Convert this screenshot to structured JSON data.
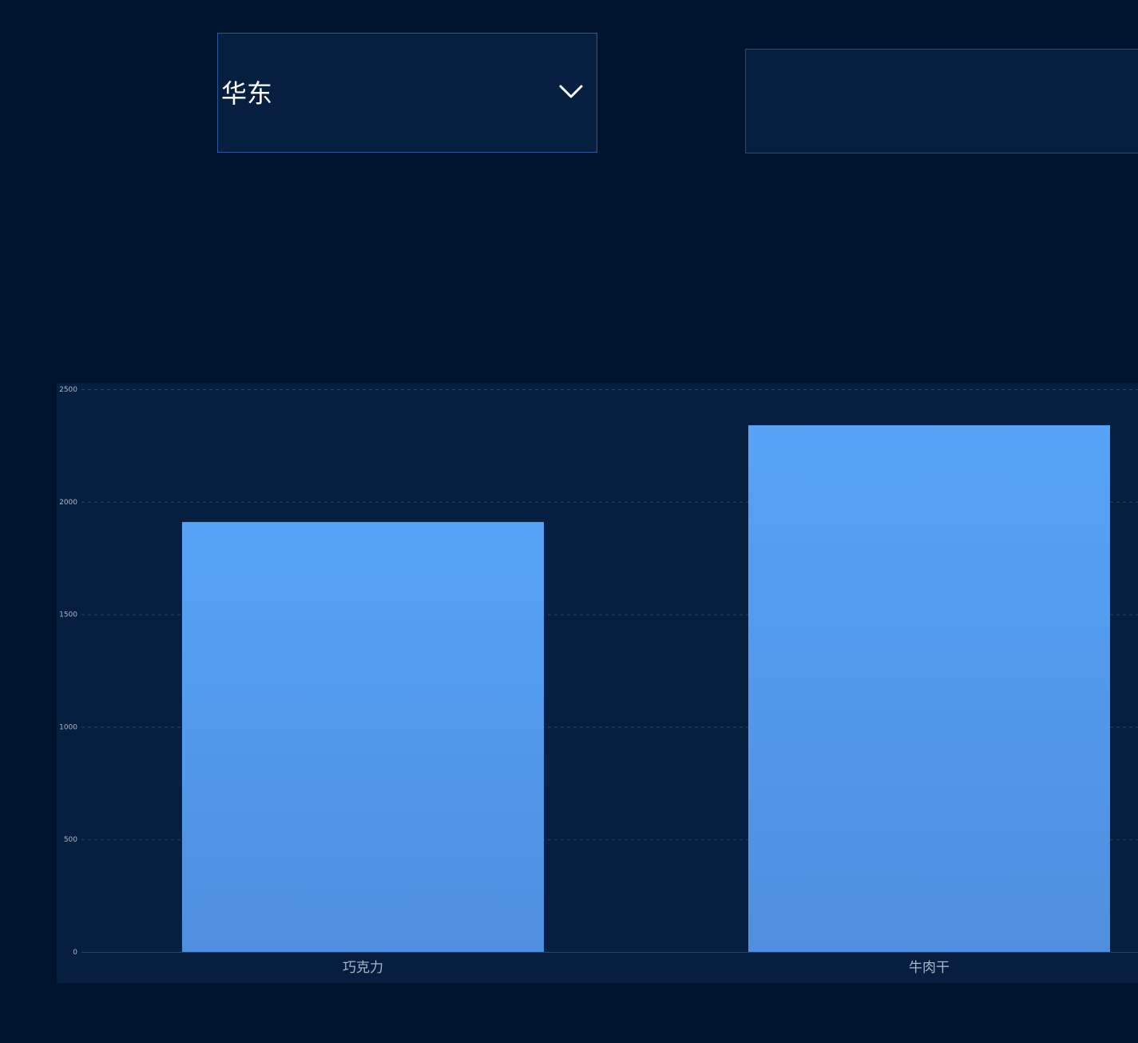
{
  "filter": {
    "region_value": "华东",
    "chevron_icon": "chevron-down-icon"
  },
  "secondary_panel": {},
  "colors": {
    "page_background": "#00142d",
    "panel_background": "#061f40",
    "panel_border": "#2a5a9c",
    "bar_top": "#56a3f8",
    "bar_bottom": "#4f8fdf",
    "gridline": "#2a4466",
    "tick_text": "#a9b6c8"
  },
  "chart_data": {
    "type": "bar",
    "categories": [
      "巧克力",
      "牛肉干"
    ],
    "values": [
      1910,
      2340
    ],
    "ylim": [
      0,
      2500
    ],
    "yticks": [
      "0",
      "500",
      "1000",
      "1500",
      "2000",
      "2500"
    ],
    "grid": true,
    "legend": "none"
  }
}
